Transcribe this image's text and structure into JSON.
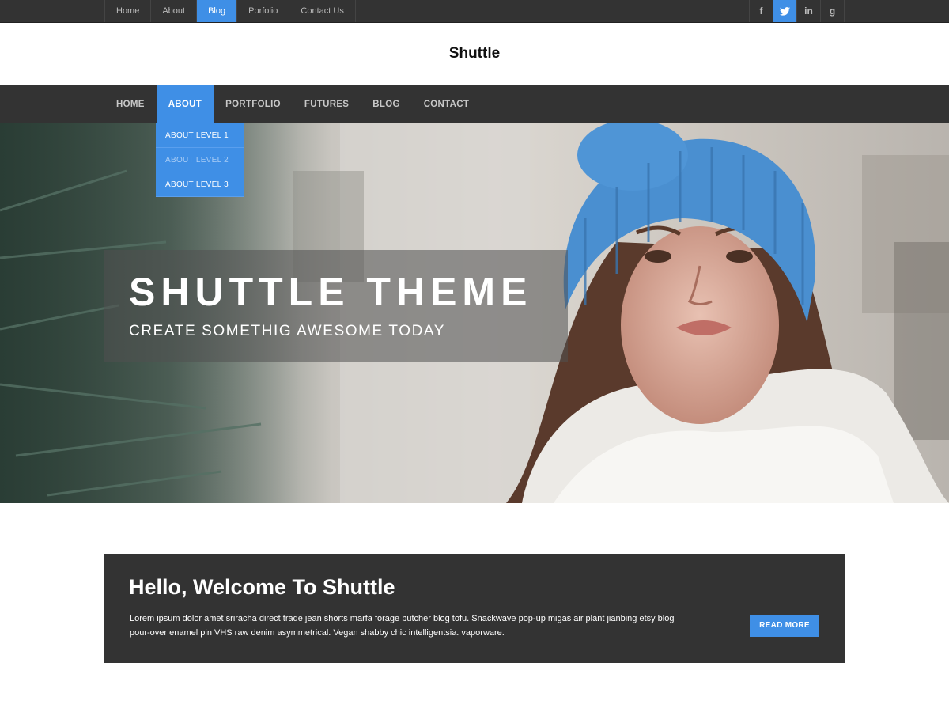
{
  "topnav": {
    "items": [
      "Home",
      "About",
      "Blog",
      "Porfolio",
      "Contact Us"
    ],
    "active_index": 2
  },
  "social": {
    "icons": [
      "facebook-icon",
      "twitter-icon",
      "linkedin-icon",
      "google-icon"
    ],
    "glyphs": [
      "f",
      "t",
      "in",
      "g"
    ],
    "active_index": 1
  },
  "site": {
    "title": "Shuttle"
  },
  "mainnav": {
    "items": [
      "HOME",
      "ABOUT",
      "PORTFOLIO",
      "FUTURES",
      "BLOG",
      "CONTACT"
    ],
    "active_index": 1,
    "dropdown": [
      "ABOUT LEVEL 1",
      "ABOUT LEVEL 2",
      "ABOUT LEVEL 3"
    ]
  },
  "hero": {
    "title": "SHUTTLE THEME",
    "subtitle": "CREATE SOMETHIG AWESOME TODAY"
  },
  "welcome": {
    "title": "Hello, Welcome To Shuttle",
    "text": "Lorem ipsum dolor amet sriracha direct trade jean shorts marfa forage butcher blog tofu. Snackwave pop-up migas air plant  jianbing etsy blog pour-over enamel pin VHS raw denim asymmetrical. Vegan shabby chic intelligentsia. vaporware.",
    "button": "READ MORE"
  },
  "colors": {
    "accent": "#3f8fe6",
    "dark": "#333333"
  }
}
